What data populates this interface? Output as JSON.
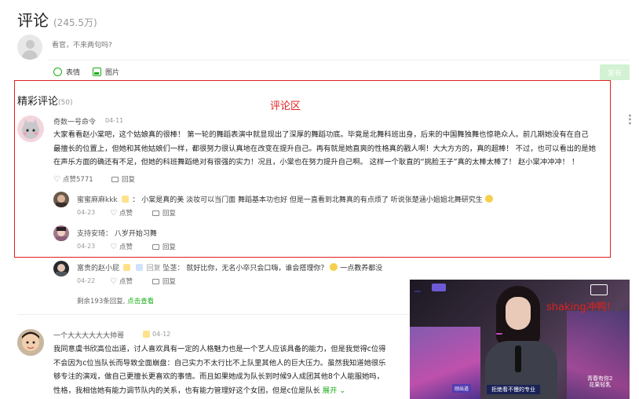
{
  "header": {
    "title": "评论",
    "count": "(245.5万)"
  },
  "composer": {
    "placeholder": "看官，不来两句吗?",
    "emoji_label": "表情",
    "image_label": "图片",
    "publish_label": "发布"
  },
  "annotation": {
    "red_label": "评论区",
    "video_label": "shaking冲鸭!"
  },
  "section": {
    "title": "精彩评论",
    "count": "(50)"
  },
  "comment1": {
    "name": "奇数一号命令",
    "date": "04-11",
    "lines": [
      "大家看看赵小棠吧，这个姑娘真的很棒！ 第一轮的舞蹈表演中就显现出了深厚的舞蹈功底。毕竟是北舞科班出身，后来的中国舞独舞也惊艳众人。前几期她没有在自己",
      "最擅长的位置上，但她和其他姑娘们一样，都很努力很认真地在改变在提升自己。再有就是她直爽的性格真的戳人啊！大大方方的，真的超棒！ 不过，也可以看出的是她",
      "在声乐方面的确还有不足，但她的科班舞蹈绝对有很强的实力！况且，小棠也在努力提升自己啊。 这样一个耿直的“挑脸王子”真的太棒太棒了！ 赵小棠冲冲冲！   ！"
    ],
    "likes": "点赞5771",
    "reply": "回复"
  },
  "replies": [
    {
      "name": "蜜蜜麻麻kkk",
      "text": "小棠是真的美 淡妆可以当门面 舞蹈基本功也好 但是一直看到北舞真的有点烦了 听说张楚涵小姐姐北舞研究生",
      "date": "04-23",
      "like": "点赞",
      "reply": "回复"
    },
    {
      "name": "支持安琦：",
      "text": "八岁开始习舞",
      "date": "04-23",
      "like": "点赞",
      "reply": "回复"
    },
    {
      "name": "富贵的赵小屁",
      "reply_label": "回复",
      "reply_to": "坠茎：",
      "text": "就好比你，无名小卒只会口嗨，谁会搭理你？",
      "text_after": "一点教养都没",
      "date": "04-22",
      "like": "点赞",
      "reply": "回复"
    }
  ],
  "more_replies": {
    "text": "剩余193条回复,",
    "link": "点击查看"
  },
  "comment2": {
    "name": "一个大大大大大大帅哥",
    "date": "04-12",
    "lines": [
      "我同意虞书欣高位出道，讨人喜欢具有一定的人格魅力也是一个艺人应该具备的能力，但是我觉得c位得",
      "不会因为c位当队长而导致全面崩盘：自己实力不太行比不上队里其他人的巨大压力。虽然我知道她很乐",
      "够专注的演戏，做自己更擅长更喜欢的事情。而且如果她成为队长到时候9人成团其他8个人能服她吗，",
      "性格，我相信她有能力调节队内的关系，也有能力管理好这个女团，但是c位是队长"
    ],
    "expand": "展开"
  },
  "video": {
    "caption": "拒绝看不慢的专业",
    "caption_left": "刚出道",
    "brand_top": "青春有你2",
    "brand_bottom": "花果轻乳"
  }
}
